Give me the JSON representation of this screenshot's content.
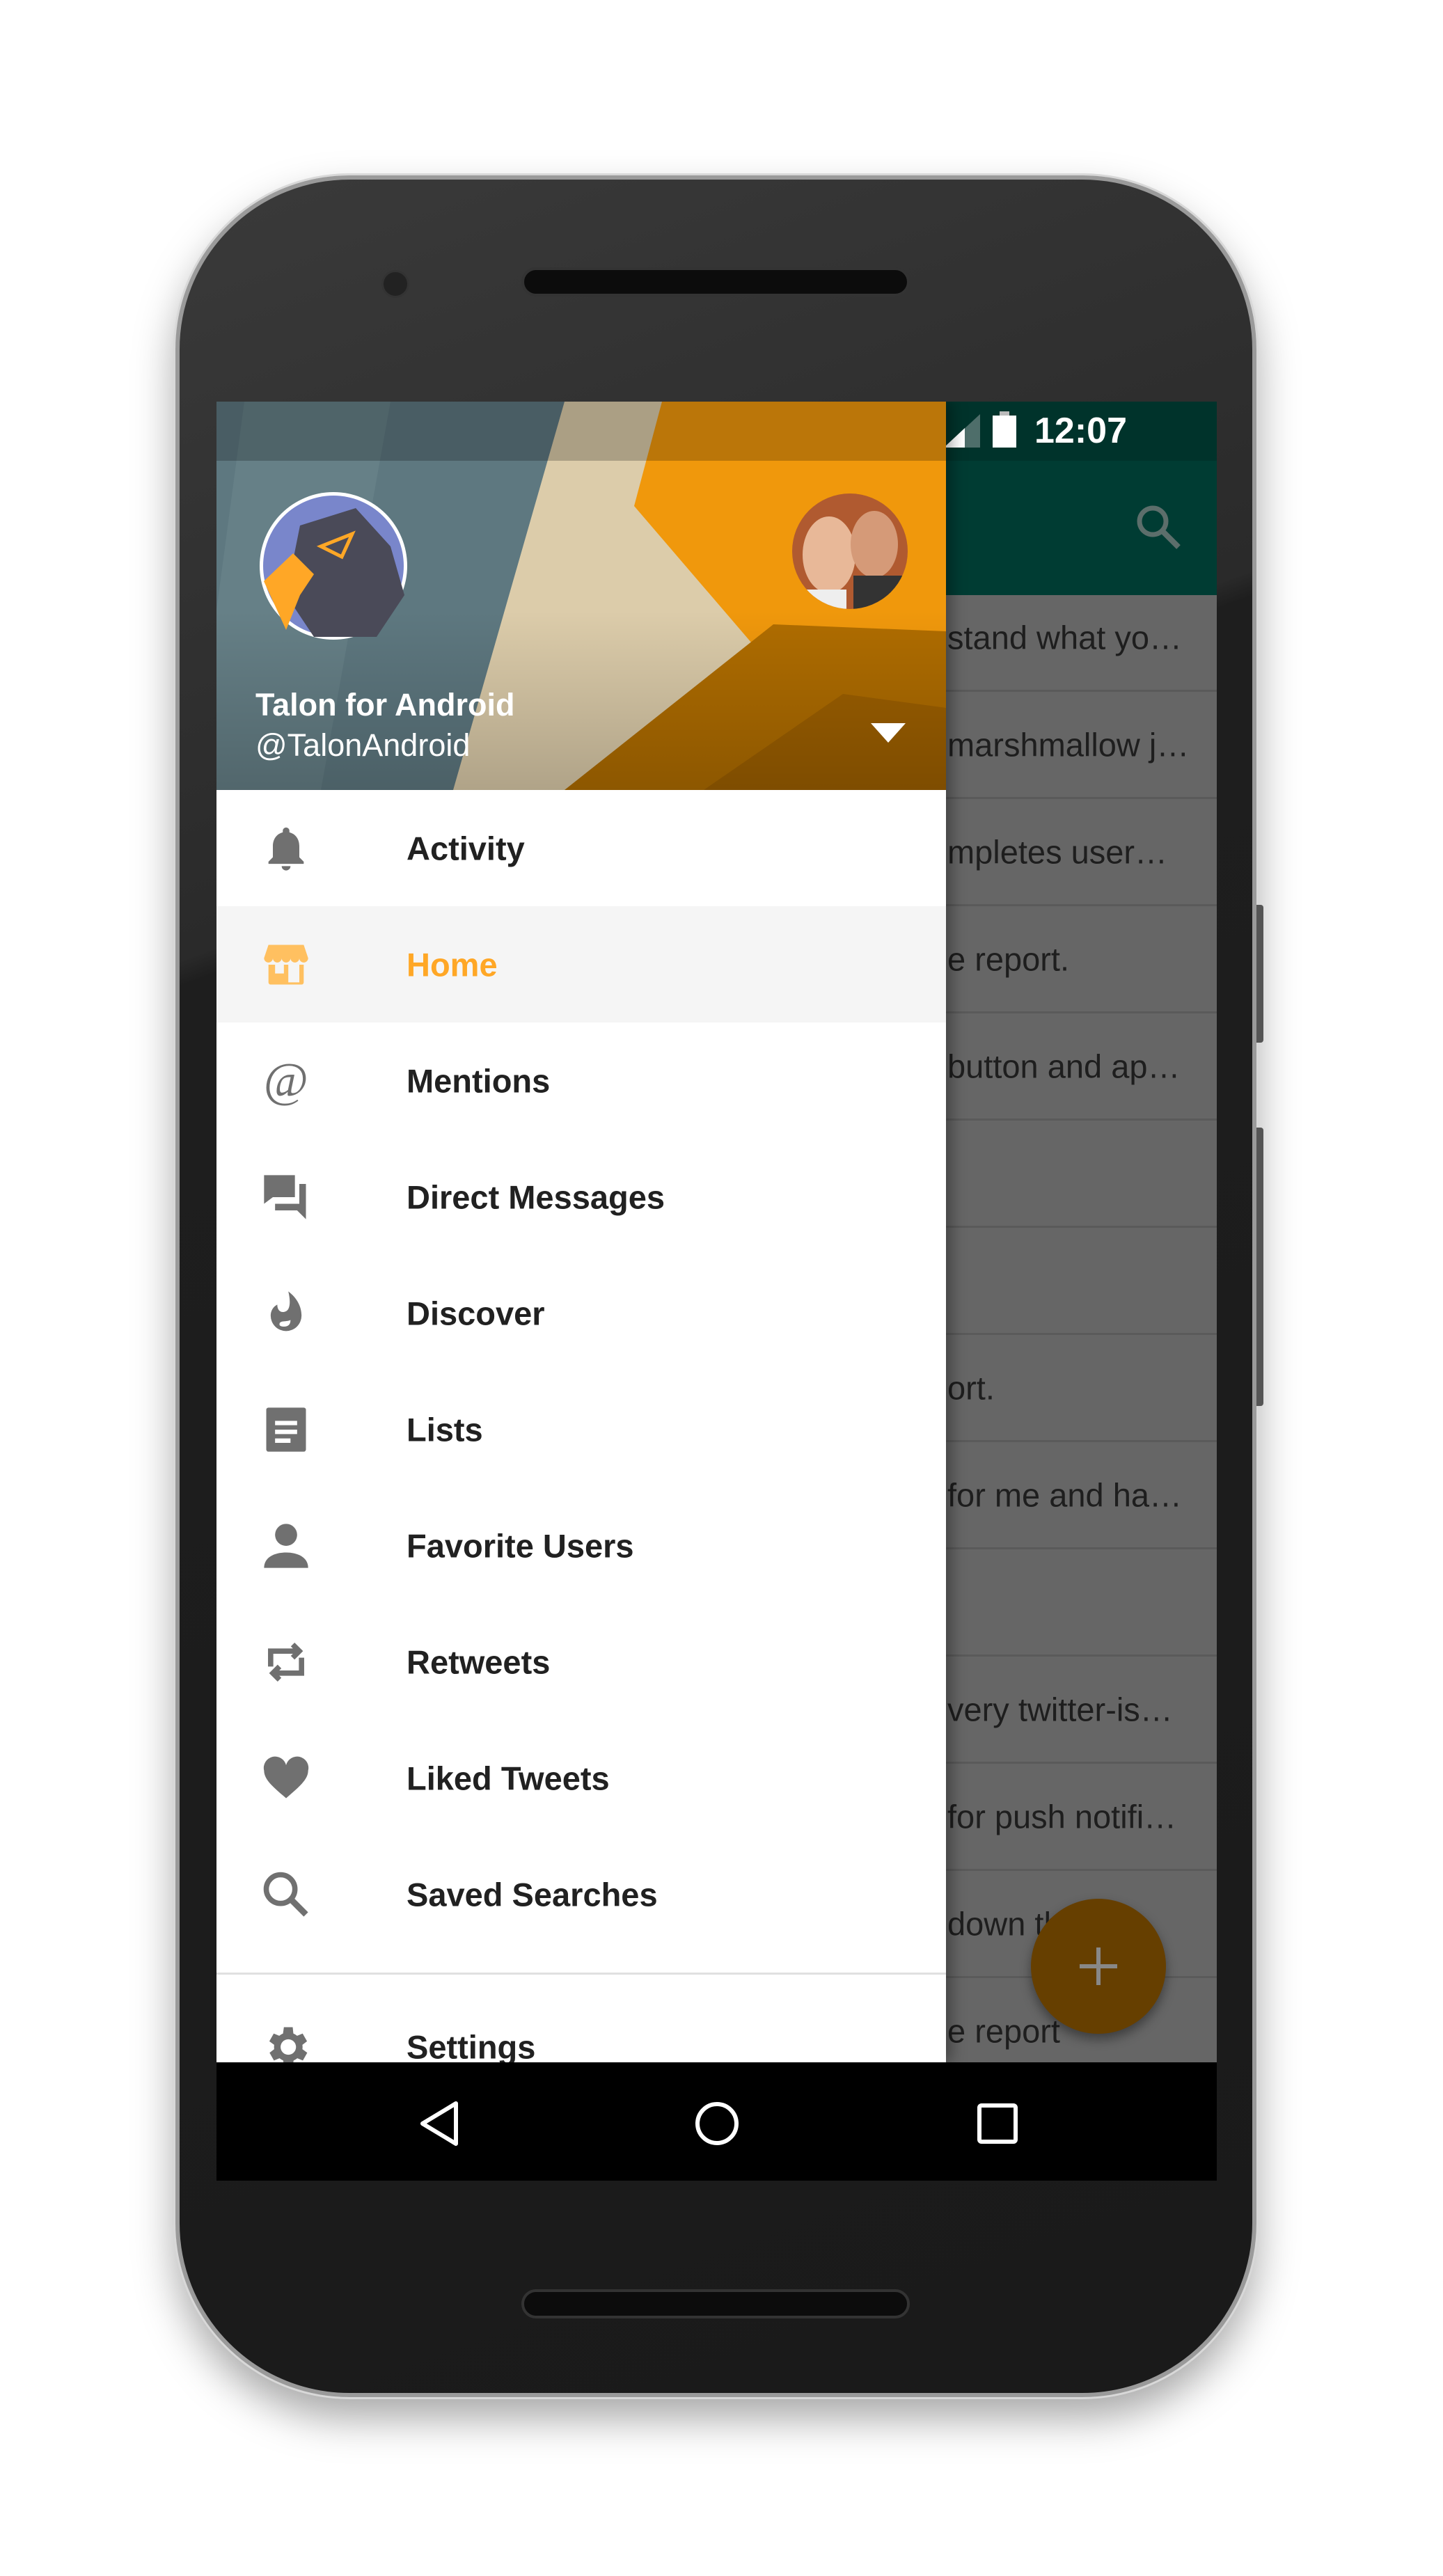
{
  "status_bar": {
    "time": "12:07",
    "icons": [
      "wifi-icon",
      "signal-icon",
      "battery-icon"
    ]
  },
  "toolbar": {
    "search_icon": "search-icon"
  },
  "timeline": {
    "rows": [
      "stand what yo…",
      "marshmallow j…",
      "mpletes user…",
      "e report.",
      "button and ap…",
      "",
      "",
      "ort.",
      "for me and ha…",
      "",
      "very twitter-is…",
      "for push notifi…",
      "down th…",
      "e report"
    ]
  },
  "fab": {
    "icon": "plus-icon"
  },
  "drawer": {
    "account": {
      "name": "Talon for Android",
      "handle": "@TalonAndroid"
    },
    "items": [
      {
        "label": "Activity",
        "icon": "bell-icon"
      },
      {
        "label": "Home",
        "icon": "store-icon",
        "selected": true
      },
      {
        "label": "Mentions",
        "icon": "at-icon"
      },
      {
        "label": "Direct Messages",
        "icon": "chat-icon"
      },
      {
        "label": "Discover",
        "icon": "flame-icon"
      },
      {
        "label": "Lists",
        "icon": "list-icon"
      },
      {
        "label": "Favorite Users",
        "icon": "person-icon"
      },
      {
        "label": "Retweets",
        "icon": "retweet-icon"
      },
      {
        "label": "Liked Tweets",
        "icon": "heart-icon"
      },
      {
        "label": "Saved Searches",
        "icon": "search-icon"
      }
    ],
    "settings": {
      "label": "Settings",
      "icon": "gear-icon"
    }
  },
  "colors": {
    "accent": "#ffa726",
    "toolbar": "#004d40",
    "text": "#212121",
    "icon": "#707070"
  }
}
